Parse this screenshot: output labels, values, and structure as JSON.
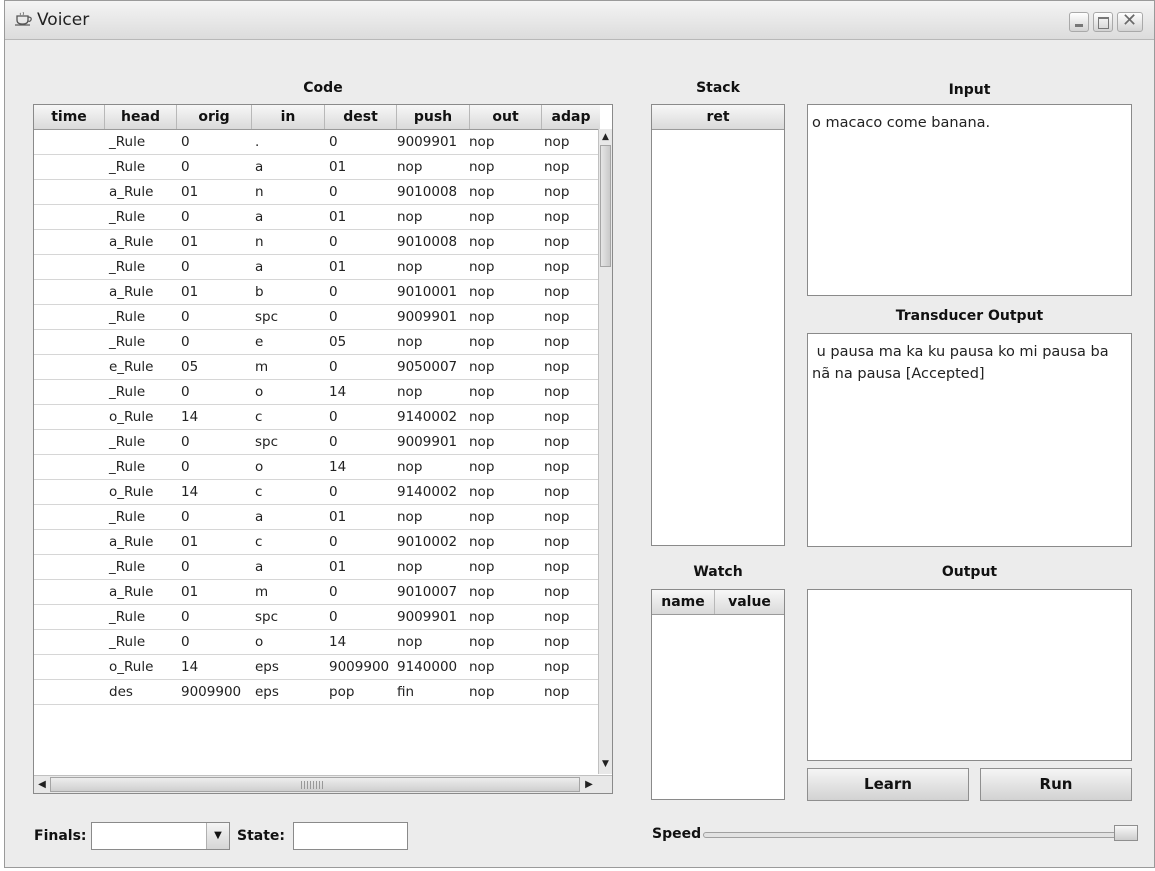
{
  "window": {
    "title": "Voicer",
    "controls": [
      "minimize",
      "maximize",
      "close"
    ]
  },
  "code": {
    "title": "Code",
    "columns": [
      "time",
      "head",
      "orig",
      "in",
      "dest",
      "push",
      "out",
      "adap"
    ],
    "rows": [
      [
        "",
        "_Rule",
        "0",
        ".",
        "0",
        "9009901",
        "nop",
        "nop"
      ],
      [
        "",
        "_Rule",
        "0",
        "a",
        "01",
        "nop",
        "nop",
        "nop"
      ],
      [
        "",
        "a_Rule",
        "01",
        "n",
        "0",
        "9010008",
        "nop",
        "nop"
      ],
      [
        "",
        "_Rule",
        "0",
        "a",
        "01",
        "nop",
        "nop",
        "nop"
      ],
      [
        "",
        "a_Rule",
        "01",
        "n",
        "0",
        "9010008",
        "nop",
        "nop"
      ],
      [
        "",
        "_Rule",
        "0",
        "a",
        "01",
        "nop",
        "nop",
        "nop"
      ],
      [
        "",
        "a_Rule",
        "01",
        "b",
        "0",
        "9010001",
        "nop",
        "nop"
      ],
      [
        "",
        "_Rule",
        "0",
        "spc",
        "0",
        "9009901",
        "nop",
        "nop"
      ],
      [
        "",
        "_Rule",
        "0",
        "e",
        "05",
        "nop",
        "nop",
        "nop"
      ],
      [
        "",
        "e_Rule",
        "05",
        "m",
        "0",
        "9050007",
        "nop",
        "nop"
      ],
      [
        "",
        "_Rule",
        "0",
        "o",
        "14",
        "nop",
        "nop",
        "nop"
      ],
      [
        "",
        "o_Rule",
        "14",
        "c",
        "0",
        "9140002",
        "nop",
        "nop"
      ],
      [
        "",
        "_Rule",
        "0",
        "spc",
        "0",
        "9009901",
        "nop",
        "nop"
      ],
      [
        "",
        "_Rule",
        "0",
        "o",
        "14",
        "nop",
        "nop",
        "nop"
      ],
      [
        "",
        "o_Rule",
        "14",
        "c",
        "0",
        "9140002",
        "nop",
        "nop"
      ],
      [
        "",
        "_Rule",
        "0",
        "a",
        "01",
        "nop",
        "nop",
        "nop"
      ],
      [
        "",
        "a_Rule",
        "01",
        "c",
        "0",
        "9010002",
        "nop",
        "nop"
      ],
      [
        "",
        "_Rule",
        "0",
        "a",
        "01",
        "nop",
        "nop",
        "nop"
      ],
      [
        "",
        "a_Rule",
        "01",
        "m",
        "0",
        "9010007",
        "nop",
        "nop"
      ],
      [
        "",
        "_Rule",
        "0",
        "spc",
        "0",
        "9009901",
        "nop",
        "nop"
      ],
      [
        "",
        "_Rule",
        "0",
        "o",
        "14",
        "nop",
        "nop",
        "nop"
      ],
      [
        "",
        "o_Rule",
        "14",
        "eps",
        "9009900",
        "9140000",
        "nop",
        "nop"
      ],
      [
        "",
        "des",
        "9009900",
        "eps",
        "pop",
        "fin",
        "nop",
        "nop"
      ]
    ]
  },
  "stack": {
    "title": "Stack",
    "column": "ret"
  },
  "watch": {
    "title": "Watch",
    "columns": [
      "name",
      "value"
    ]
  },
  "input": {
    "title": "Input",
    "value": "o macaco come banana."
  },
  "transducer_output": {
    "title": "Transducer Output",
    "value": " u pausa ma ka ku pausa ko mi pausa ba nã na pausa [Accepted]"
  },
  "output": {
    "title": "Output",
    "value": ""
  },
  "buttons": {
    "learn": "Learn",
    "run": "Run"
  },
  "bottom": {
    "finals_label": "Finals:",
    "finals_value": "",
    "state_label": "State:",
    "state_value": "",
    "speed_label": "Speed",
    "speed_level": 1.0
  }
}
